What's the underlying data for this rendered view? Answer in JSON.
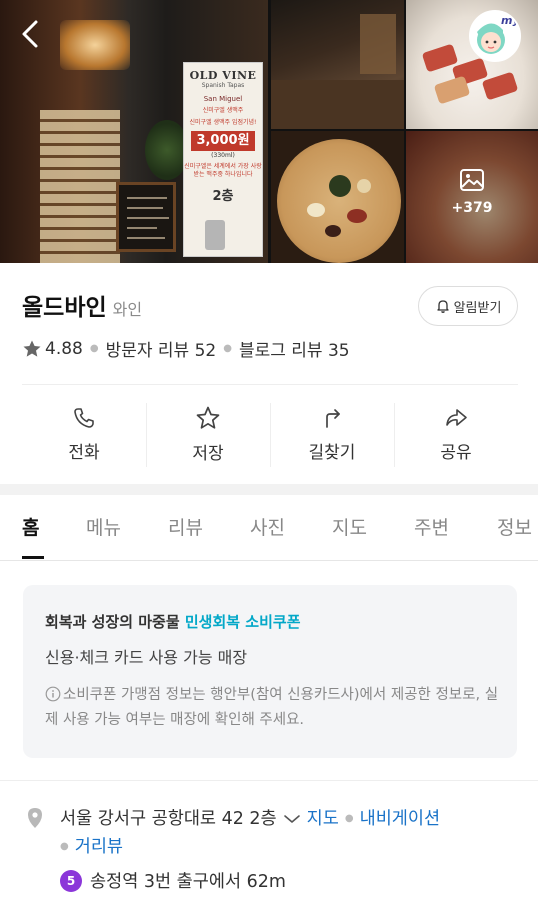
{
  "photos": {
    "more_count": "+379",
    "sign_title": "OLD VINE",
    "sign_subtitle": "Spanish Tapas",
    "sign_brand": "San Miguel",
    "sign_line1": "신미구엘 생맥주",
    "sign_line2": "신미구엘 생맥주 입점기념!",
    "sign_price": "3,000원",
    "sign_volume": "(330ml)",
    "sign_promo": "신미구엘은 세계에서 가장 사랑받는 맥주중 하나입니다",
    "sign_floor": "2층"
  },
  "profile": {
    "badge": "my"
  },
  "place": {
    "name": "올드바인",
    "category": "와인",
    "rating": "4.88",
    "visitor_reviews": "방문자 리뷰 52",
    "blog_reviews": "블로그 리뷰 35",
    "notify_label": "알림받기"
  },
  "actions": [
    {
      "label": "전화",
      "icon": "phone-icon"
    },
    {
      "label": "저장",
      "icon": "star-icon"
    },
    {
      "label": "길찾기",
      "icon": "directions-icon"
    },
    {
      "label": "공유",
      "icon": "share-icon"
    }
  ],
  "tabs": [
    "홈",
    "메뉴",
    "리뷰",
    "사진",
    "지도",
    "주변",
    "정보"
  ],
  "active_tab": "홈",
  "coupon": {
    "headline": "회복과 성장의 마중물 ",
    "headline_accent": "민생회복 소비쿠폰",
    "subtitle": "신용·체크 카드 사용 가능 매장",
    "note": "소비쿠폰 가맹점 정보는 행안부(참여 신용카드사)에서 제공한 정보로, 실제 사용 가능 여부는 매장에 확인해 주세요."
  },
  "location": {
    "address": "서울 강서구 공항대로 42 2층",
    "map_link": "지도",
    "navigation_link": "내비게이션",
    "street_view_link": "거리뷰",
    "subway_line": "5",
    "subway_text": "송정역 3번 출구에서 62m"
  },
  "colors": {
    "accent_coupon": "#03a8c8",
    "link": "#1a73c8",
    "subway_line5": "#8b36d9"
  }
}
